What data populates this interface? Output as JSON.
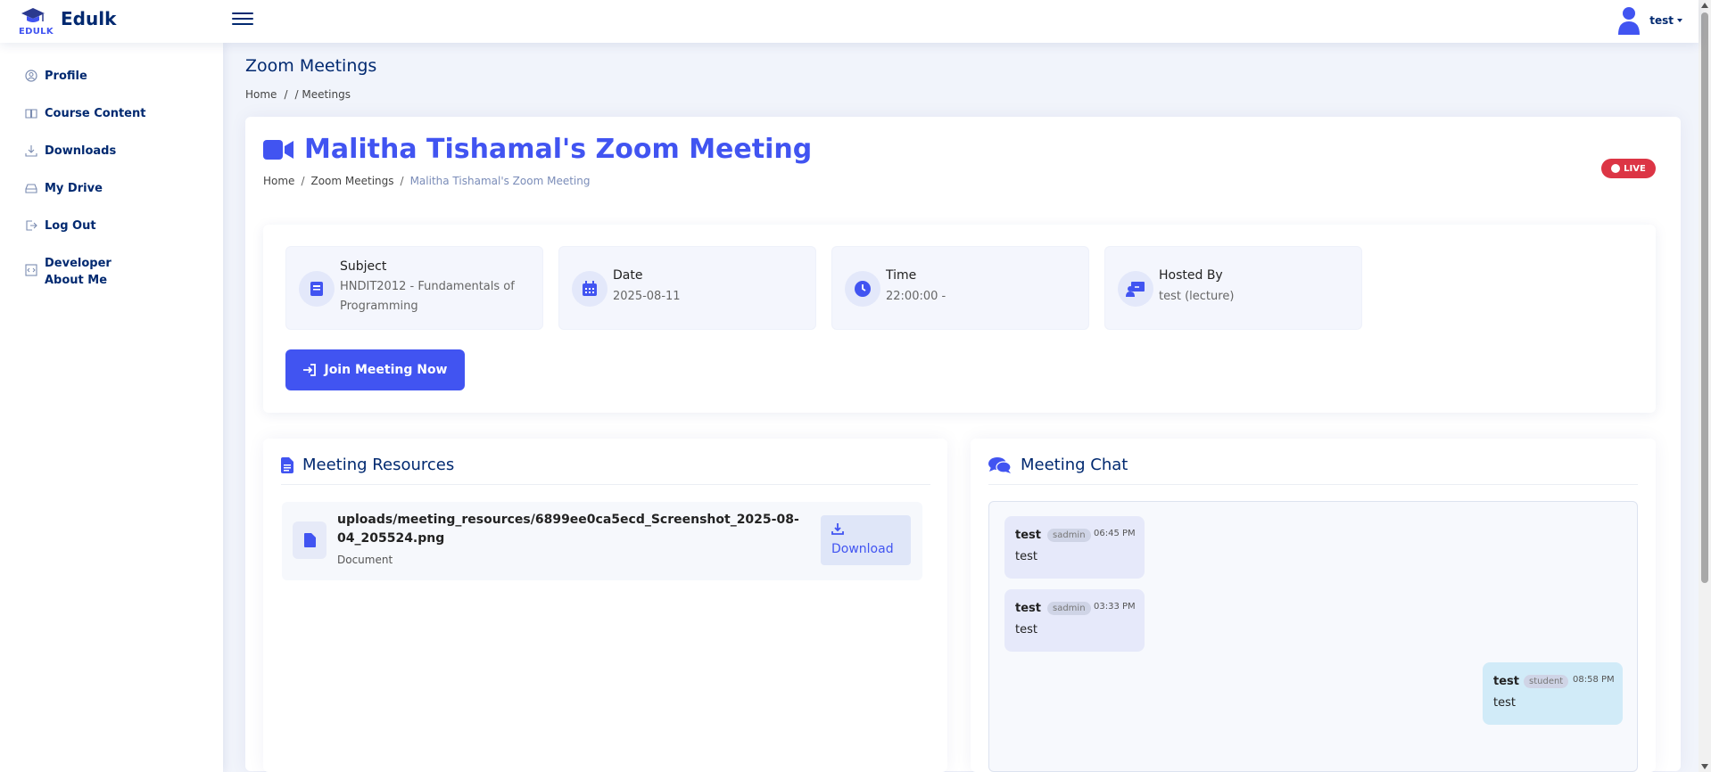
{
  "brand": {
    "name": "Edulk",
    "small": "EDULK"
  },
  "user": {
    "name": "test"
  },
  "sidebar": {
    "items": [
      {
        "label": "Profile",
        "icon": "person-circle-icon"
      },
      {
        "label": "Course Content",
        "icon": "book-icon"
      },
      {
        "label": "Downloads",
        "icon": "download-icon"
      },
      {
        "label": "My Drive",
        "icon": "drive-icon"
      },
      {
        "label": "Log Out",
        "icon": "logout-icon"
      },
      {
        "label": "Developer",
        "label2": "About Me",
        "icon": "code-icon"
      }
    ]
  },
  "page": {
    "title": "Zoom Meetings",
    "breadcrumb": [
      "Home",
      "/",
      "/ Meetings"
    ]
  },
  "meeting": {
    "title": "Malitha Tishamal's Zoom Meeting",
    "breadcrumb": {
      "home": "Home",
      "section": "Zoom Meetings",
      "sep": "/",
      "current": "Malitha Tishamal's Zoom Meeting"
    },
    "status": "LIVE",
    "info": {
      "subject_label": "Subject",
      "subject_value": "HNDIT2012 - Fundamentals of Programming",
      "date_label": "Date",
      "date_value": "2025-08-11",
      "time_label": "Time",
      "time_value": "22:00:00 -",
      "host_label": "Hosted By",
      "host_value": "test (lecture)"
    },
    "join_label": "Join Meeting Now"
  },
  "resources": {
    "title": "Meeting Resources",
    "items": [
      {
        "name": "uploads/meeting_resources/6899ee0ca5ecd_Screenshot_2025-08-04_205524.png",
        "type": "Document",
        "action": "Download"
      }
    ]
  },
  "chat": {
    "title": "Meeting Chat",
    "messages": [
      {
        "user": "test",
        "role": "sadmin",
        "time": "06:45 PM",
        "text": "test"
      },
      {
        "user": "test",
        "role": "sadmin",
        "time": "03:33 PM",
        "text": "test"
      },
      {
        "user": "test",
        "role": "student",
        "time": "08:58 PM",
        "text": "test"
      }
    ]
  },
  "colors": {
    "primary": "#4154f1",
    "navy": "#012970",
    "live": "#dc3545",
    "chat_in": "#e6e9fa",
    "chat_out": "#d1ebf8"
  }
}
